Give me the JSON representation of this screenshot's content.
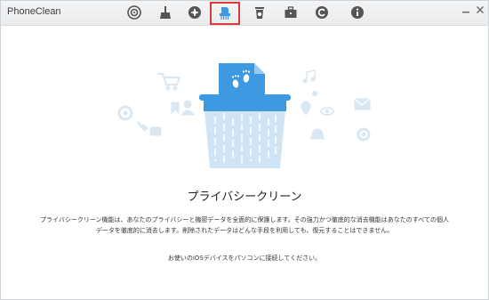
{
  "app": {
    "title": "PhoneClean"
  },
  "toolbar": {
    "tools": [
      {
        "icon": "quick-clean-icon"
      },
      {
        "icon": "broom-icon"
      },
      {
        "icon": "toolbox-icon"
      },
      {
        "icon": "shredder-icon",
        "selected": true
      },
      {
        "icon": "trash-bin-icon"
      },
      {
        "icon": "briefcase-icon"
      },
      {
        "icon": "history-icon"
      },
      {
        "icon": "info-icon"
      }
    ],
    "window_controls": [
      "minimize-icon",
      "close-icon"
    ]
  },
  "main": {
    "heading": "プライバシークリーン",
    "description_line1": "プライバシークリーン機能は、あなたのプライバシーと機密データを全面的に保護します。その強力かつ徹底的な消去機能はあなたのすべての個人",
    "description_line2": "データを徹底的に消去します。削除されたデータはどんな手段を利用しても、復元することはできません。",
    "note": "お使いのiOSデバイスをパソコンに接続してください。"
  },
  "colors": {
    "accent": "#3d9ae2",
    "light_accent": "#cfe5f6",
    "highlight_box": "#d93b3b"
  }
}
